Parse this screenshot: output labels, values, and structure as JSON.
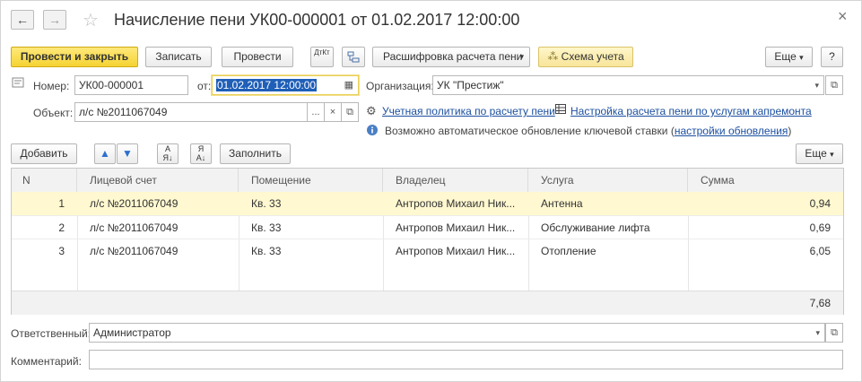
{
  "window": {
    "title": "Начисление пени УК00-000001 от 01.02.2017 12:00:00",
    "back_icon": "←",
    "forward_icon": "→",
    "star_icon": "☆",
    "close_icon": "×"
  },
  "toolbar": {
    "post_close": "Провести и закрыть",
    "save": "Записать",
    "post": "Провести",
    "dtkt": "ДтКт",
    "decode": "Расшифровка расчета пени",
    "scheme": "Схема учета",
    "more": "Еще",
    "help": "?"
  },
  "form": {
    "number_label": "Номер:",
    "number_value": "УК00-000001",
    "date_label": "от:",
    "date_value": "01.02.2017 12:00:00",
    "org_label": "Организация:",
    "org_value": "УК \"Престиж\"",
    "object_label": "Объект:",
    "object_value": "л/с №2011067049",
    "link_policy": "Учетная политика по расчету пени",
    "link_settings": "Настройка расчета пени по услугам капремонта",
    "info_text": "Возможно автоматическое обновление ключевой ставки (",
    "info_link": "настройки обновления",
    "info_close": ")"
  },
  "table_toolbar": {
    "add": "Добавить",
    "fill": "Заполнить",
    "more": "Еще"
  },
  "table": {
    "columns": [
      "N",
      "Лицевой счет",
      "Помещение",
      "Владелец",
      "Услуга",
      "Сумма"
    ],
    "rows": [
      {
        "n": "1",
        "account": "л/с №2011067049",
        "room": "Кв. 33",
        "owner": "Антропов Михаил Ник...",
        "service": "Антенна",
        "sum": "0,94"
      },
      {
        "n": "2",
        "account": "л/с №2011067049",
        "room": "Кв. 33",
        "owner": "Антропов Михаил Ник...",
        "service": "Обслуживание лифта",
        "sum": "0,69"
      },
      {
        "n": "3",
        "account": "л/с №2011067049",
        "room": "Кв. 33",
        "owner": "Антропов Михаил Ник...",
        "service": "Отопление",
        "sum": "6,05"
      }
    ],
    "total": "7,68"
  },
  "bottom": {
    "responsible_label": "Ответственный:",
    "responsible_value": "Администратор",
    "comment_label": "Комментарий:",
    "comment_value": ""
  },
  "colors": {
    "primary_button": "#f5d333",
    "selected_row": "#fff8d0",
    "link": "#1b4fa0"
  }
}
